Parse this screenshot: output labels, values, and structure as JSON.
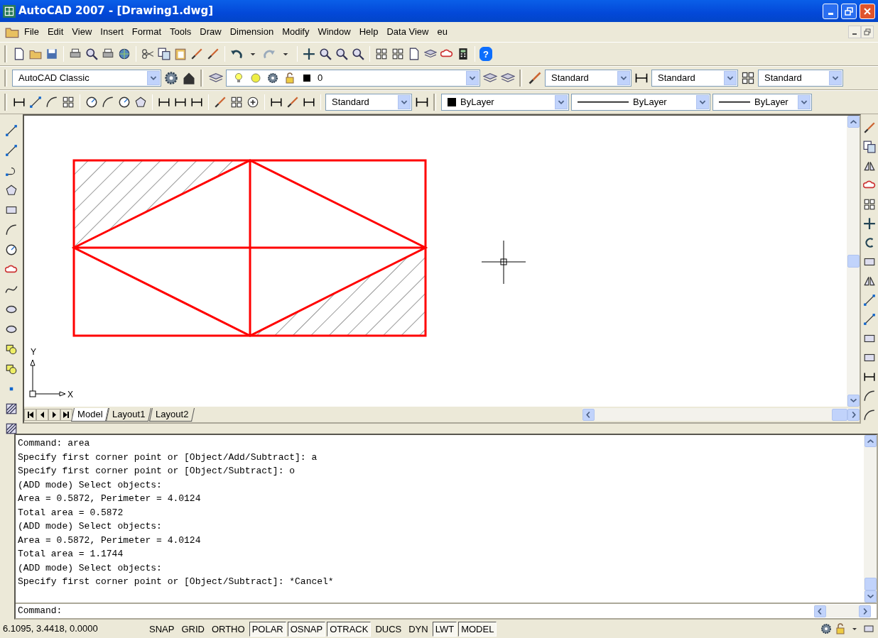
{
  "window": {
    "title": "AutoCAD 2007 - [Drawing1.dwg]"
  },
  "menu": [
    "File",
    "Edit",
    "View",
    "Insert",
    "Format",
    "Tools",
    "Draw",
    "Dimension",
    "Modify",
    "Window",
    "Help",
    "Data View",
    "eu"
  ],
  "toolbars": {
    "help_button": "?",
    "workspace": "AutoCAD Classic",
    "layer": "0",
    "text_style": "Standard",
    "dim_style": "Standard",
    "table_style": "Standard",
    "dim_style_2": "Standard",
    "color_setting": "ByLayer",
    "linetype": "ByLayer",
    "lineweight": "ByLayer"
  },
  "drawing": {
    "ucs_labels": [
      "Y",
      "X"
    ]
  },
  "layout_tabs": [
    {
      "label": "Model",
      "selected": true
    },
    {
      "label": "Layout1",
      "selected": false
    },
    {
      "label": "Layout2",
      "selected": false
    }
  ],
  "command_history": [
    "Command: area",
    "Specify first corner point or [Object/Add/Subtract]: a",
    "Specify first corner point or [Object/Subtract]: o",
    "(ADD mode) Select objects:",
    "Area = 0.5872, Perimeter = 4.0124",
    "Total area = 0.5872",
    "(ADD mode) Select objects:",
    "Area = 0.5872, Perimeter = 4.0124",
    "Total area = 1.1744",
    "(ADD mode) Select objects:",
    "Specify first corner point or [Object/Subtract]: *Cancel*"
  ],
  "command_prompt": "Command:",
  "status_bar": {
    "coordinates": "6.1095, 3.4418, 0.0000",
    "toggles": [
      {
        "label": "SNAP",
        "on": false
      },
      {
        "label": "GRID",
        "on": false
      },
      {
        "label": "ORTHO",
        "on": false
      },
      {
        "label": "POLAR",
        "on": true
      },
      {
        "label": "OSNAP",
        "on": true
      },
      {
        "label": "OTRACK",
        "on": true
      },
      {
        "label": "DUCS",
        "on": false
      },
      {
        "label": "DYN",
        "on": false
      },
      {
        "label": "LWT",
        "on": true
      },
      {
        "label": "MODEL",
        "on": true
      }
    ]
  }
}
